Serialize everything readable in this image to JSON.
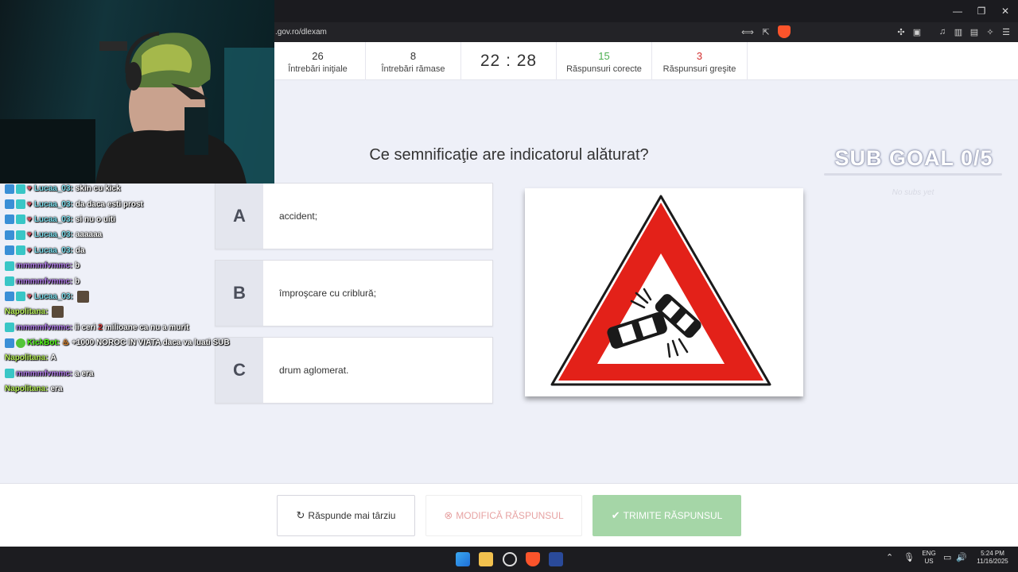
{
  "browser": {
    "url": ".gov.ro/dlexam",
    "window_controls": {
      "minimize": "—",
      "restore": "❐",
      "close": "✕"
    }
  },
  "stats": {
    "initial": {
      "value": "26",
      "label": "Întrebări iniţiale"
    },
    "remaining": {
      "value": "8",
      "label": "Întrebări rămase"
    },
    "timer": "22 : 28",
    "correct": {
      "value": "15",
      "label": "Răspunsuri corecte"
    },
    "wrong": {
      "value": "3",
      "label": "Răspunsuri greşite"
    }
  },
  "question": "Ce semnificaţie are indicatorul alăturat?",
  "answers": [
    {
      "letter": "A",
      "text": "accident;"
    },
    {
      "letter": "B",
      "text": "împroşcare cu criblură;"
    },
    {
      "letter": "C",
      "text": "drum aglomerat."
    }
  ],
  "actions": {
    "later": "Răspunde mai târziu",
    "modify": "MODIFICĂ RĂSPUNSUL",
    "submit": "TRIMITE RĂSPUNSUL"
  },
  "overlay": {
    "sub_goal": "SUB GOAL 0/5",
    "sub_goal_note": "No subs yet",
    "chat": [
      {
        "user": "Lucaa_03:",
        "message": "skin cu kick"
      },
      {
        "user": "Lucaa_03:",
        "message": "da daca esti prost"
      },
      {
        "user": "Lucaa_03:",
        "message": "si nu o uiti"
      },
      {
        "user": "Lucaa_03:",
        "message": "aaaaaa"
      },
      {
        "user": "Lucaa_03:",
        "message": "da"
      },
      {
        "user": "mmmmfvmmc:",
        "message": "b"
      },
      {
        "user": "mmmmfvmmc:",
        "message": "b"
      },
      {
        "user": "Lucaa_03:",
        "message": ""
      },
      {
        "user": "Napolitana:",
        "message": ""
      },
      {
        "user": "mmmmfvmmc:",
        "message": "ii ceri",
        "emote": "2",
        "message2": "milioane ca nu a murit"
      },
      {
        "user": "KickBot:",
        "message": "+1000 NOROC IN VIATA daca va luati SUB"
      },
      {
        "user": "Napolitana:",
        "message": "A"
      },
      {
        "user": "mmmmfvmmc:",
        "message": "a era"
      },
      {
        "user": "Napolitana:",
        "message": "era"
      }
    ]
  },
  "taskbar": {
    "lang": "ENG",
    "region": "US",
    "time": "5:24 PM",
    "date": "11/16/2025"
  },
  "colors": {
    "correct": "#4caf50",
    "wrong": "#d32f2f",
    "submit_bg": "#a5d6a7",
    "sign_red": "#e32119"
  }
}
